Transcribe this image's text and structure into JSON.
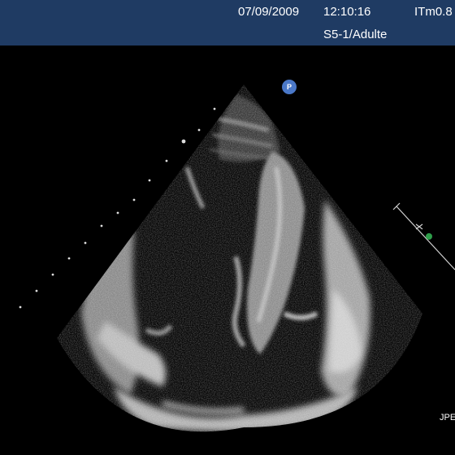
{
  "header": {
    "date": "07/09/2009",
    "time": "12:10:16",
    "index": "ITm0.8",
    "probe": "S5-1/Adulte"
  },
  "markers": {
    "orientation": "P",
    "corner_label": "JPE"
  },
  "colors": {
    "header_background": "#1f3b63",
    "header_text": "#ffffff",
    "image_background": "#000000",
    "orientation_marker": "#4a78c8",
    "caliper_point": "#2e9e4a"
  },
  "icons": {
    "orientation_marker": "p-orientation-icon",
    "caliper": "caliper-icon"
  }
}
